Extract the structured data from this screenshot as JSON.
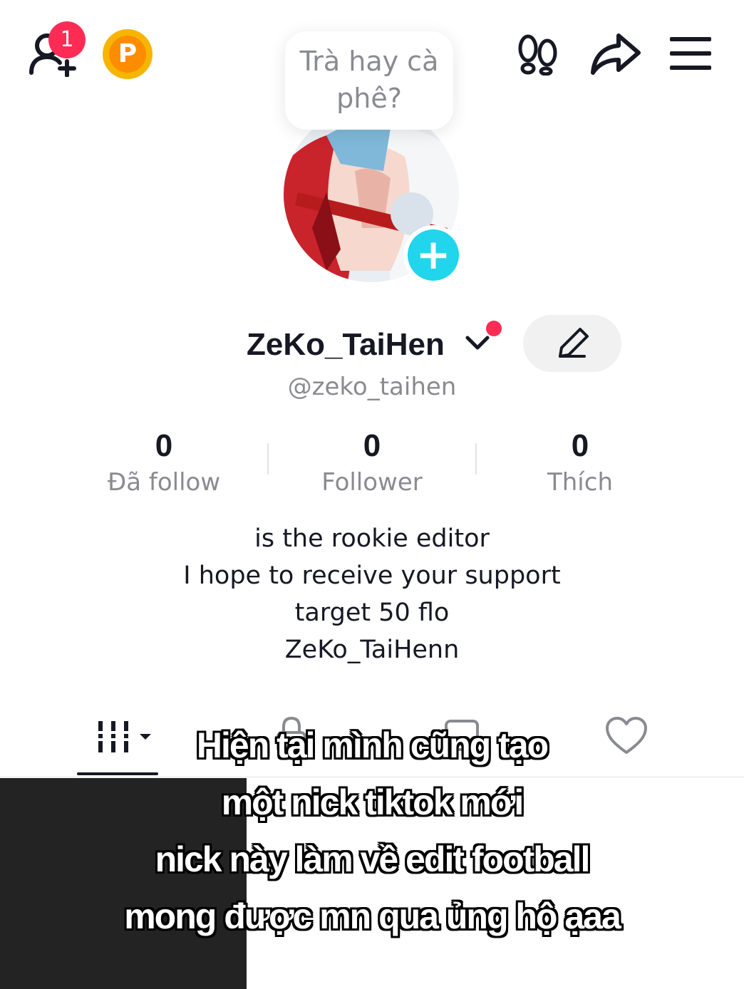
{
  "top_bar": {
    "notification_count": "1",
    "coin_label": "P",
    "note_line1": "Trà hay cà",
    "note_line2": "phê?"
  },
  "profile": {
    "display_name": "ZeKo_TaiHen",
    "username": "@zeko_taihen"
  },
  "stats": [
    {
      "value": "0",
      "label": "Đã follow"
    },
    {
      "value": "0",
      "label": "Follower"
    },
    {
      "value": "0",
      "label": "Thích"
    }
  ],
  "bio": [
    "is the rookie editor",
    "I hope to receive your support",
    "target 50 flo",
    "ZeKo_TaiHenn"
  ],
  "caption": [
    "Hiện tại mình cũng tạo",
    "một nick tiktok mới",
    "nick này làm về edit football",
    "mong được mn qua ủng hộ ạaa"
  ],
  "colors": {
    "accent_red": "#fe2c55",
    "accent_cyan": "#20d5ec",
    "coin_gold": "#f7b500",
    "text_secondary": "#8a8b91"
  },
  "icons": [
    "add-friend-icon",
    "coin-icon",
    "footprint-icon",
    "share-icon",
    "menu-icon",
    "edit-pencil-icon",
    "grid-icon",
    "lock-icon",
    "repost-icon",
    "heart-icon"
  ]
}
